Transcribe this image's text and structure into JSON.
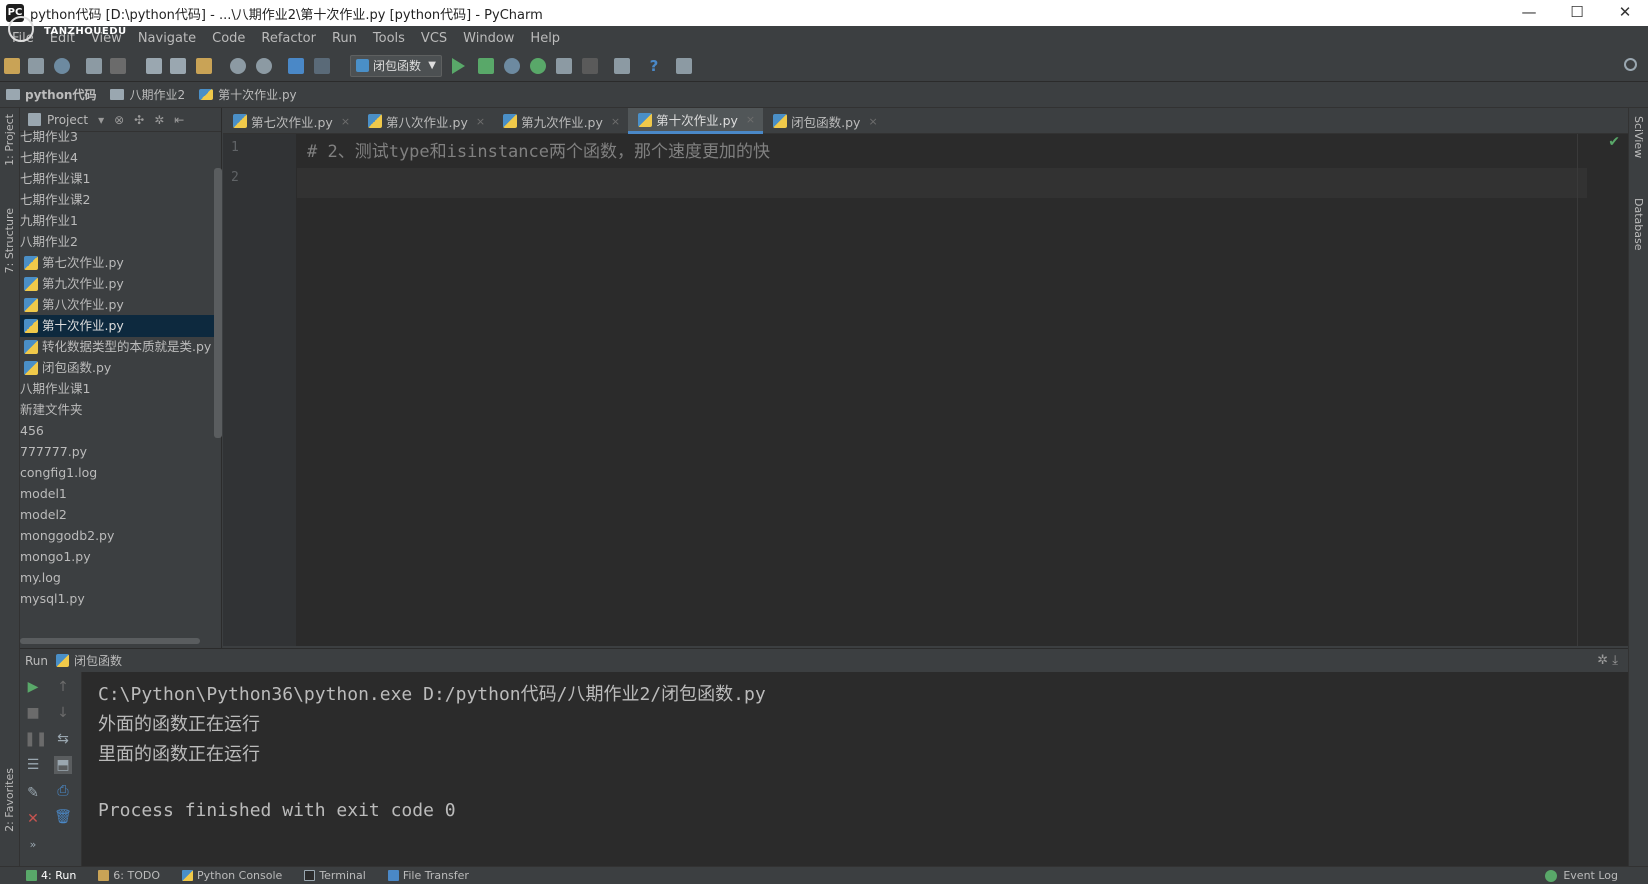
{
  "window": {
    "title": "python代码 [D:\\python代码] - ...\\八期作业2\\第十次作业.py [python代码] - PyCharm",
    "watermark": "TANZHOUEDU"
  },
  "menu": [
    "File",
    "Edit",
    "View",
    "Navigate",
    "Code",
    "Refactor",
    "Run",
    "Tools",
    "VCS",
    "Window",
    "Help"
  ],
  "toolbar": {
    "run_config": "闭包函数"
  },
  "breadcrumb": [
    "python代码",
    "八期作业2",
    "第十次作业.py"
  ],
  "left_strip": {
    "project": "1: Project",
    "structure": "7: Structure",
    "favorites": "2: Favorites"
  },
  "right_strip": {
    "sciview": "SciView",
    "database": "Database"
  },
  "project_panel": {
    "header": "Project",
    "items": [
      {
        "label": "七期作业3",
        "type": "folder",
        "selected": false
      },
      {
        "label": "七期作业4",
        "type": "folder",
        "selected": false
      },
      {
        "label": "七期作业课1",
        "type": "folder",
        "selected": false
      },
      {
        "label": "七期作业课2",
        "type": "folder",
        "selected": false
      },
      {
        "label": "九期作业1",
        "type": "folder",
        "selected": false
      },
      {
        "label": "八期作业2",
        "type": "folder",
        "selected": false
      },
      {
        "label": "第七次作业.py",
        "type": "py",
        "selected": false
      },
      {
        "label": "第九次作业.py",
        "type": "py",
        "selected": false
      },
      {
        "label": "第八次作业.py",
        "type": "py",
        "selected": false
      },
      {
        "label": "第十次作业.py",
        "type": "py",
        "selected": true
      },
      {
        "label": "转化数据类型的本质就是类.py",
        "type": "py",
        "selected": false
      },
      {
        "label": "闭包函数.py",
        "type": "py",
        "selected": false
      },
      {
        "label": "八期作业课1",
        "type": "folder",
        "selected": false
      },
      {
        "label": "新建文件夹",
        "type": "folder",
        "selected": false
      },
      {
        "label": "456",
        "type": "file",
        "selected": false
      },
      {
        "label": "777777.py",
        "type": "file",
        "selected": false
      },
      {
        "label": "congfig1.log",
        "type": "file",
        "selected": false
      },
      {
        "label": "model1",
        "type": "file",
        "selected": false
      },
      {
        "label": "model2",
        "type": "file",
        "selected": false
      },
      {
        "label": "monggodb2.py",
        "type": "file",
        "selected": false
      },
      {
        "label": "mongo1.py",
        "type": "file",
        "selected": false
      },
      {
        "label": "my.log",
        "type": "file",
        "selected": false
      },
      {
        "label": "mysql1.py",
        "type": "file",
        "selected": false
      }
    ]
  },
  "editor_tabs": [
    {
      "label": "第七次作业.py",
      "active": false
    },
    {
      "label": "第八次作业.py",
      "active": false
    },
    {
      "label": "第九次作业.py",
      "active": false
    },
    {
      "label": "第十次作业.py",
      "active": true
    },
    {
      "label": "闭包函数.py",
      "active": false
    }
  ],
  "editor": {
    "lines": [
      {
        "num": "1",
        "text": "# 2、测试type和isinstance两个函数，那个速度更加的快"
      },
      {
        "num": "2",
        "text": ""
      }
    ]
  },
  "run_panel": {
    "label": "Run",
    "config": "闭包函数",
    "output": [
      "C:\\Python\\Python36\\python.exe D:/python代码/八期作业2/闭包函数.py",
      "外面的函数正在运行",
      "里面的函数正在运行",
      "",
      "Process finished with exit code 0"
    ]
  },
  "bottom_tabs": [
    "4: Run",
    "6: TODO",
    "Python Console",
    "Terminal",
    "File Transfer"
  ],
  "event_log": "Event Log",
  "colors": {
    "accent": "#4a88c7",
    "selection": "#0d293e",
    "editor_bg": "#2b2b2b",
    "panel_bg": "#3c3f41",
    "run_green": "#59a869"
  }
}
